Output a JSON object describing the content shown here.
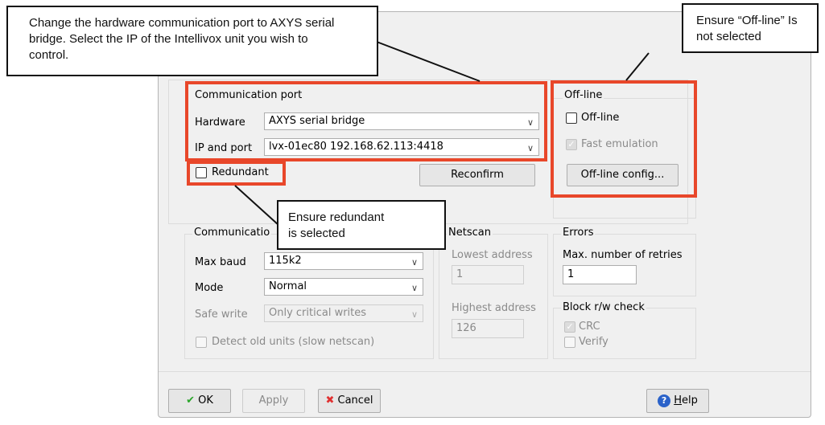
{
  "callouts": {
    "hardware": "Change the hardware communication port to AXYS serial bridge. Select the IP of the Intellivox unit you wish to control.",
    "offline": "Ensure “Off-line” Is not selected",
    "redundant": "Ensure redundant is selected"
  },
  "communication_port": {
    "title": "Communication port",
    "hardware_label": "Hardware",
    "hardware_value": "AXYS serial bridge",
    "ip_label": "IP and port",
    "ip_value": "lvx-01ec80 192.168.62.113:4418",
    "redundant_label": "Redundant",
    "reconfirm_label": "Reconfirm"
  },
  "offline_group": {
    "title": "Off-line",
    "offline_label": "Off-line",
    "fast_emulation_label": "Fast emulation",
    "config_button": "Off-line config..."
  },
  "communication": {
    "title": "Communicatio",
    "max_baud_label": "Max baud",
    "max_baud_value": "115k2",
    "mode_label": "Mode",
    "mode_value": "Normal",
    "safe_write_label": "Safe write",
    "safe_write_value": "Only critical writes",
    "detect_old_label": "Detect old units (slow netscan)"
  },
  "netscan": {
    "title": "Netscan",
    "lowest_label": "Lowest address",
    "lowest_value": "1",
    "highest_label": "Highest address",
    "highest_value": "126"
  },
  "errors": {
    "title": "Errors",
    "retries_label": "Max. number of retries",
    "retries_value": "1"
  },
  "block_check": {
    "title": "Block r/w check",
    "crc_label": "CRC",
    "verify_label": "Verify"
  },
  "buttons": {
    "ok": "OK",
    "apply": "Apply",
    "cancel": "Cancel",
    "help_pre": "",
    "help_u": "H",
    "help_post": "elp"
  },
  "colors": {
    "highlight": "#e8472a",
    "ok_check": "#2aa52a",
    "cancel_x": "#e03030",
    "help_icon": "#2a62c9"
  }
}
